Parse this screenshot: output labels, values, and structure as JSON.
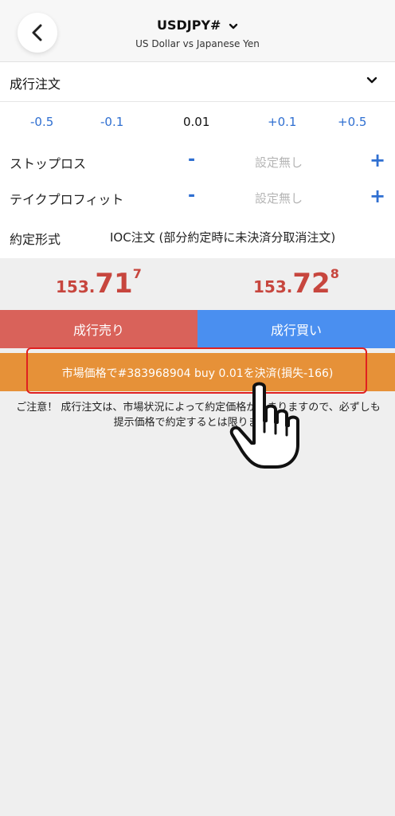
{
  "header": {
    "symbol": "USDJPY#",
    "subtitle": "US Dollar vs Japanese Yen"
  },
  "order": {
    "type_label": "成行注文"
  },
  "volume": {
    "minus_large": "-0.5",
    "minus_small": "-0.1",
    "value": "0.01",
    "plus_small": "+0.1",
    "plus_large": "+0.5"
  },
  "stop_loss": {
    "label": "ストップロス",
    "minus": "-",
    "value": "設定無し",
    "plus": "+"
  },
  "take_profit": {
    "label": "テイクプロフィット",
    "minus": "-",
    "value": "設定無し",
    "plus": "+"
  },
  "fill_policy": {
    "label": "約定形式",
    "value": "IOC注文 (部分約定時に未決済分取消注文)"
  },
  "prices": {
    "bid_prefix": "153.",
    "bid_main": "71",
    "bid_sup": "7",
    "ask_prefix": "153.",
    "ask_main": "72",
    "ask_sup": "8"
  },
  "buttons": {
    "sell": "成行売り",
    "buy": "成行買い",
    "close": "市場価格で#383968904 buy 0.01を決済(損失-166)"
  },
  "notice": "ご注意！ 成行注文は、市場状況によって約定価格がきまりますので、必ずしも提示価格で約定するとは限りません!",
  "colors": {
    "sell": "#d9625a",
    "buy": "#4a8ff0",
    "close": "#e69138",
    "price": "#c7463e",
    "accent": "#2f6fd1",
    "highlight": "#e02020"
  },
  "icons": [
    "back-chevron-icon",
    "symbol-dropdown-icon",
    "order-type-dropdown-icon",
    "pointing-hand-icon"
  ]
}
